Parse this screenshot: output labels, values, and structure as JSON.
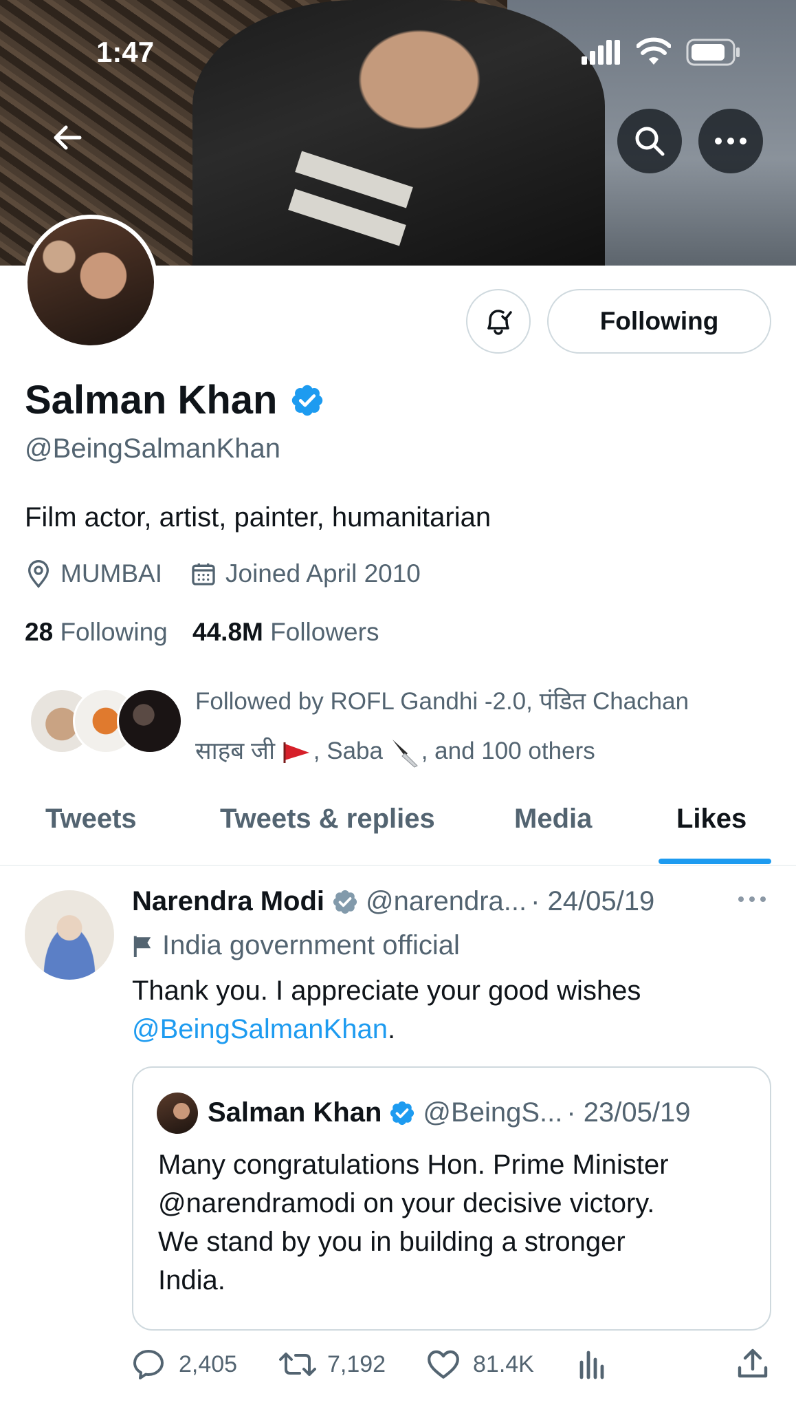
{
  "status_bar": {
    "time": "1:47"
  },
  "profile": {
    "name": "Salman Khan",
    "handle": "@BeingSalmanKhan",
    "bio": "Film actor, artist, painter, humanitarian",
    "location": "MUMBAI",
    "joined": "Joined April 2010",
    "following_count": "28",
    "following_label": "Following",
    "followers_count": "44.8M",
    "followers_label": "Followers",
    "followed_by_line1": "Followed by ROFL Gandhi -2.0, पंडित Chachan",
    "followed_by_line2_a": "साहब जी",
    "followed_by_line2_b": ", Saba",
    "followed_by_line2_c": ", and 100 others",
    "follow_button_label": "Following"
  },
  "tabs": [
    "Tweets",
    "Tweets & replies",
    "Media",
    "Likes"
  ],
  "active_tab": "Likes",
  "tweet": {
    "author": "Narendra Modi",
    "handle": "@narendra...",
    "date": "· 24/05/19",
    "label": "India government official",
    "text": "Thank you. I appreciate your good wishes",
    "mention": "@BeingSalmanKhan",
    "mention_suffix": ".",
    "quote": {
      "author": "Salman Khan",
      "handle": "@BeingS...",
      "date": "· 23/05/19",
      "lines": [
        "Many congratulations Hon. Prime Minister",
        "@narendramodi on your decisive victory.",
        "We stand by you in building a stronger",
        "India."
      ]
    },
    "replies": "2,405",
    "retweets": "7,192",
    "likes": "81.4K"
  },
  "colors": {
    "accent": "#1d9bf0",
    "text": "#0f1419",
    "muted": "#536471",
    "verified": "#1d9bf0",
    "gov_badge": "#829aab"
  }
}
